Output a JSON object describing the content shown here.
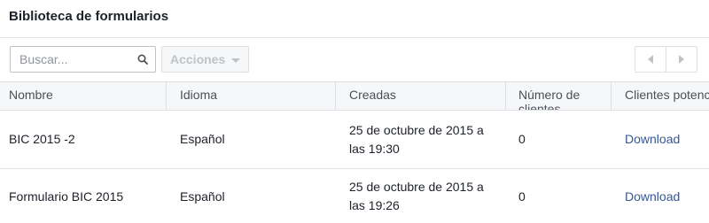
{
  "page": {
    "title": "Biblioteca de formularios"
  },
  "toolbar": {
    "search_placeholder": "Buscar...",
    "actions_label": "Acciones"
  },
  "table": {
    "columns": [
      "Nombre",
      "Idioma",
      "Creadas",
      "Número de clientes",
      "Clientes potenciales"
    ],
    "rows": [
      {
        "name": "BIC 2015 -2",
        "language": "Español",
        "created": "25 de octubre de 2015 a las 19:30",
        "count": "0",
        "leads": "Download"
      },
      {
        "name": "Formulario BIC 2015",
        "language": "Español",
        "created": "25 de octubre de 2015 a las 19:26",
        "count": "0",
        "leads": "Download"
      }
    ]
  },
  "colors": {
    "link": "#365899",
    "header_bg": "#f6f7f9",
    "border": "#dddfe2"
  }
}
